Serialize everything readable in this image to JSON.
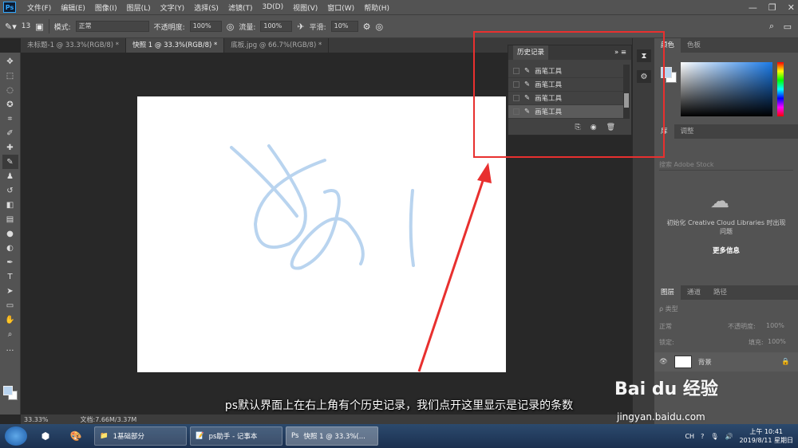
{
  "app": {
    "logo": "Ps"
  },
  "menu": [
    "文件(F)",
    "编辑(E)",
    "图像(I)",
    "图层(L)",
    "文字(Y)",
    "选择(S)",
    "滤镜(T)",
    "3D(D)",
    "视图(V)",
    "窗口(W)",
    "帮助(H)"
  ],
  "window_controls": [
    "—",
    "❐",
    "✕"
  ],
  "options": {
    "brush_size": "13",
    "mode_label": "模式:",
    "mode_value": "正常",
    "opacity_label": "不透明度:",
    "opacity_value": "100%",
    "flow_label": "流量:",
    "flow_value": "100%",
    "smooth_label": "平滑:",
    "smooth_value": "10%"
  },
  "tabs": [
    "未标题-1 @ 33.3%(RGB/8) *",
    "快照 1 @ 33.3%(RGB/8) *",
    "底板.jpg @ 66.7%(RGB/8) *"
  ],
  "status": {
    "zoom": "33.33%",
    "doc": "文档:7.66M/3.37M"
  },
  "history": {
    "title": "历史记录",
    "items": [
      "画笔工具",
      "画笔工具",
      "画笔工具",
      "画笔工具"
    ]
  },
  "right": {
    "color_tabs": [
      "颜色",
      "色板"
    ],
    "lib_tabs": [
      "库",
      "调整"
    ],
    "lib_search_placeholder": "搜索 Adobe Stock",
    "lib_msg": "初始化 Creative Cloud Libraries 时出现问题",
    "lib_more": "更多信息",
    "layer_tabs": [
      "图层",
      "通道",
      "路径"
    ],
    "layer_kind": "ρ 类型",
    "blend_mode": "正常",
    "opacity_label": "不透明度:",
    "opacity_value": "100%",
    "lock_label": "锁定:",
    "fill_label": "填充:",
    "fill_value": "100%",
    "layer_name": "背景"
  },
  "caption": "ps默认界面上在右上角有个历史记录，我们点开这里显示是记录的条数",
  "watermark": {
    "main": "Bai du 经验",
    "url": "jingyan.baidu.com"
  },
  "taskbar": {
    "tasks": [
      "1基础部分",
      "ps助手 - 记事本",
      "快照 1 @ 33.3%(..."
    ],
    "tray_lang": "CH",
    "time": "上午 10:41",
    "date": "2019/8/11 星期日"
  },
  "colors": {
    "accent": "#31a8ff",
    "highlight": "#e8302f",
    "stroke": "#b9d4ef"
  }
}
